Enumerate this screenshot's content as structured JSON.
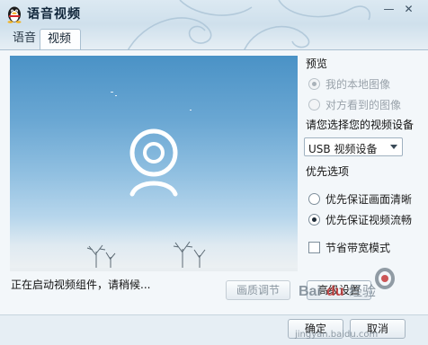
{
  "window": {
    "title": "语音视频",
    "minimize_icon": "minimize-icon",
    "close_icon": "close-icon"
  },
  "tabs": [
    {
      "label": "语音",
      "selected": false
    },
    {
      "label": "视频",
      "selected": true
    }
  ],
  "preview_area": {
    "placeholder_icon": "webcam-icon"
  },
  "status": {
    "text": "正在启动视频组件，请稍候..."
  },
  "buttons": {
    "quality": "画质调节",
    "advanced": "高级设置",
    "ok": "确定",
    "cancel": "取消"
  },
  "preview_options": {
    "title": "预览",
    "options": [
      {
        "label": "我的本地图像",
        "checked": true,
        "disabled": true
      },
      {
        "label": "对方看到的图像",
        "checked": false,
        "disabled": true
      }
    ]
  },
  "device": {
    "title": "请您选择您的视频设备",
    "selected": "USB 视频设备"
  },
  "priority": {
    "title": "优先选项",
    "options": [
      {
        "label": "优先保证画面清晰",
        "checked": false
      },
      {
        "label": "优先保证视频流畅",
        "checked": true
      }
    ]
  },
  "bandwidth": {
    "label": "节省带宽模式",
    "checked": false
  },
  "watermark": {
    "logo_text": "Baidu 经验",
    "url": "jingyan.baidu.com"
  },
  "colors": {
    "title_bg": "#cfe0ec",
    "panel_bg": "#f3f7fa",
    "preview_sky": "#6aa7d3"
  }
}
